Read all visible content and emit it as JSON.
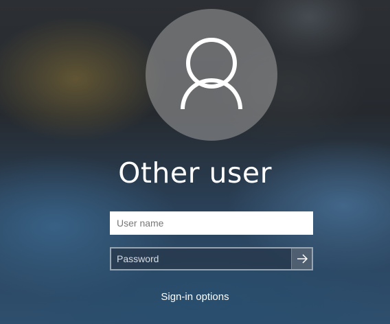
{
  "avatar": {
    "icon": "user-silhouette-icon"
  },
  "user": {
    "display_name": "Other user"
  },
  "form": {
    "username": {
      "value": "",
      "placeholder": "User name"
    },
    "password": {
      "value": "",
      "placeholder": "Password"
    },
    "submit_icon": "arrow-right-icon"
  },
  "links": {
    "signin_options": "Sign-in options"
  },
  "colors": {
    "text": "#ffffff",
    "username_field_bg": "#ffffff",
    "password_field_bg": "#28384c"
  }
}
